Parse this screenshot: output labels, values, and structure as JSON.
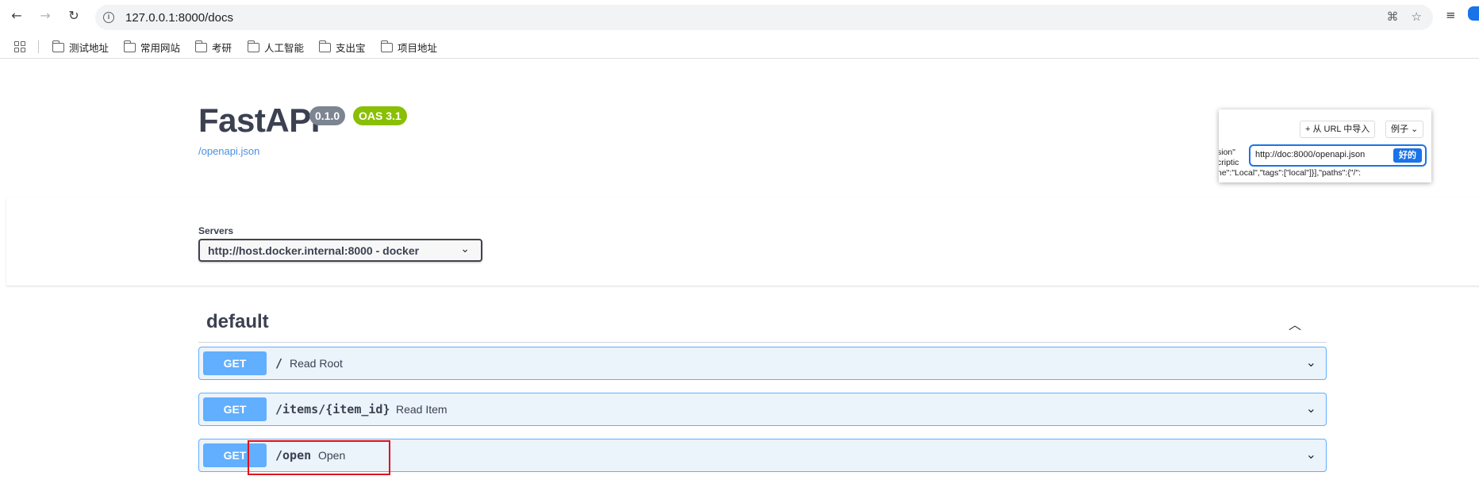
{
  "browser": {
    "url": "127.0.0.1:8000/docs",
    "bookmarks": [
      "测试地址",
      "常用网站",
      "考研",
      "人工智能",
      "支出宝",
      "项目地址"
    ]
  },
  "api": {
    "title": "FastAPI",
    "version": "0.1.0",
    "oas": "OAS 3.1",
    "spec_link": "/openapi.json"
  },
  "popup": {
    "import_label": "+ 从 URL 中导入",
    "example_label": "例子 ⌄",
    "code_lines": [
      "sion\"",
      "criptic",
      "ne\":\"Local\",\"tags\":[\"local\"]}],\"paths\":{\"/\":"
    ],
    "input_value": "http://doc:8000/openapi.json",
    "ok_label": "好的"
  },
  "servers": {
    "label": "Servers",
    "selected": "http://host.docker.internal:8000 - docker"
  },
  "tag": {
    "name": "default"
  },
  "operations": [
    {
      "method": "GET",
      "path": "/",
      "summary": "Read Root"
    },
    {
      "method": "GET",
      "path": "/items/{item_id}",
      "summary": "Read Item"
    },
    {
      "method": "GET",
      "path": "/open",
      "summary": "Open"
    }
  ],
  "colors": {
    "get_method": "#61affe",
    "get_bg": "#ebf3fb",
    "oas_badge": "#89bf04",
    "version_badge": "#7d8492",
    "highlight_box": "#e0101c"
  }
}
